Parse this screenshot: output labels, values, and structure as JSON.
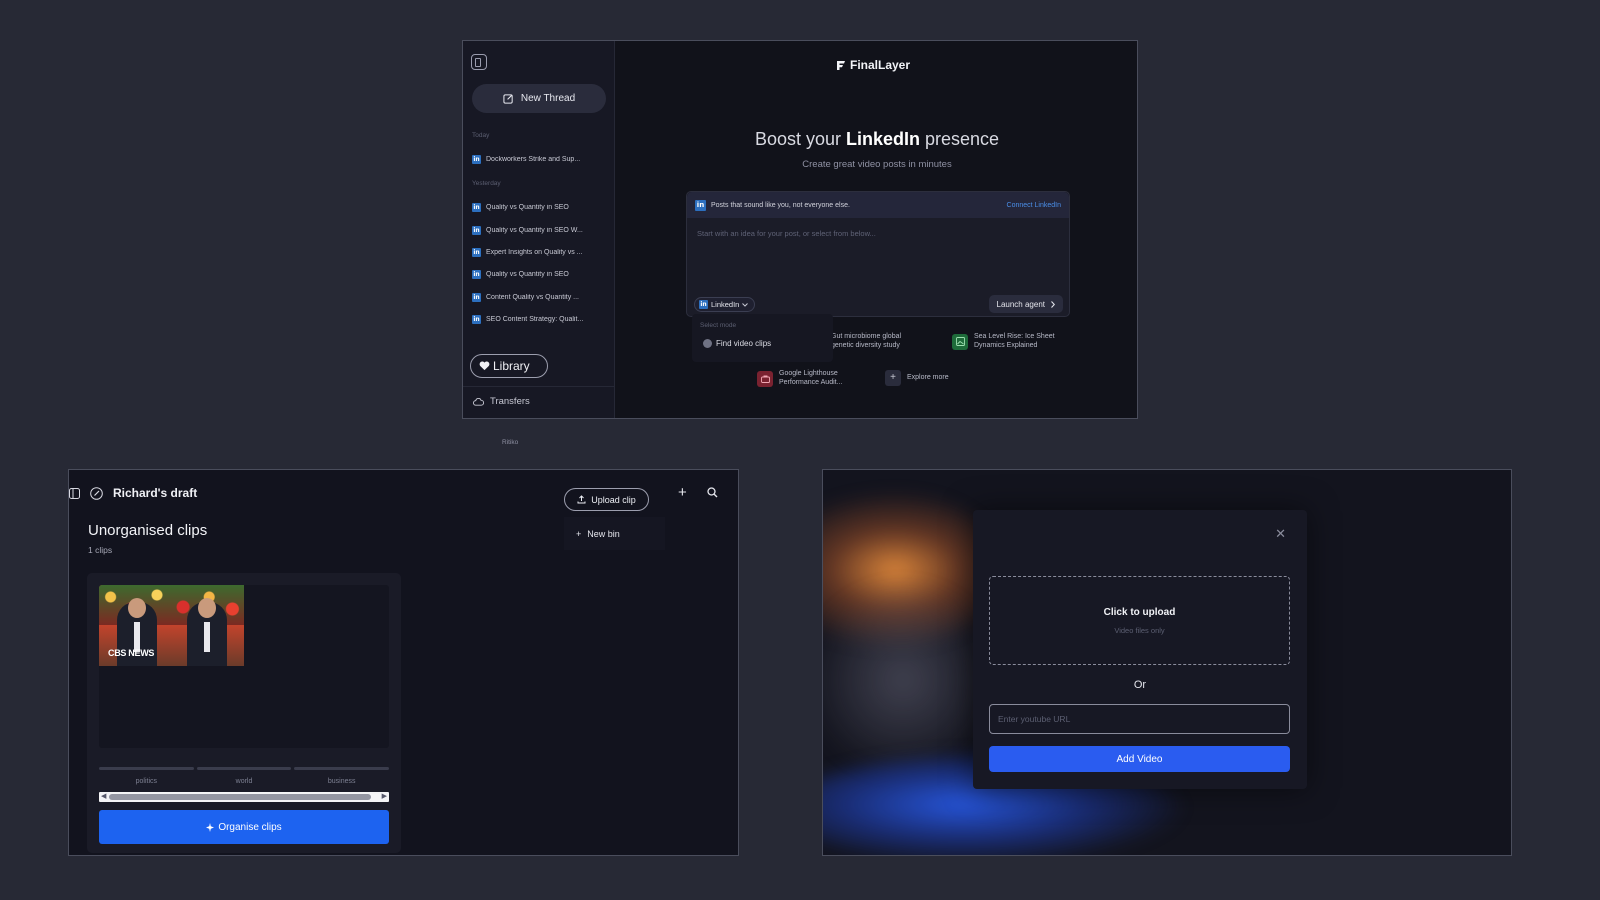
{
  "panel1": {
    "new_thread": "New Thread",
    "section_today": "Today",
    "section_yesterday": "Yesterday",
    "threads_today": [
      "Dockworkers Strike and Sup..."
    ],
    "threads_yesterday": [
      "Quality vs Quantity in SEO",
      "Quality vs Quantity in SEO W...",
      "Expert Insights on Quality vs ...",
      "Quality vs Quantity in SEO",
      "Content Quality vs Quantity ...",
      "SEO Content Strategy: Qualit..."
    ],
    "library": "Library",
    "transfers": "Transfers",
    "brand": "FinalLayer",
    "headline_pre": "Boost your ",
    "headline_bold": "LinkedIn",
    "headline_post": " presence",
    "subhead": "Create great video posts in minutes",
    "composer_banner": "Posts that sound like you, not everyone else.",
    "connect": "Connect LinkedIn",
    "composer_placeholder": "Start with an idea for your post, or select from below...",
    "platform": "LinkedIn",
    "launch": "Launch agent",
    "mode_label": "Select mode",
    "mode_option": "Find video clips",
    "suggestions": [
      {
        "line1": "Gut microbiome global",
        "line2": "genetic diversity study"
      },
      {
        "line1": "Sea Level Rise: Ice Sheet",
        "line2": "Dynamics Explained"
      },
      {
        "line1": "Google Lighthouse",
        "line2": "Performance Audit..."
      },
      {
        "line1": "Explore more",
        "line2": ""
      }
    ],
    "caption": "Ritiko"
  },
  "panel2": {
    "draft_title": "Richard's draft",
    "upload": "Upload clip",
    "new_bin": "New bin",
    "section_title": "Unorganised clips",
    "count": "1 clips",
    "watermark": "CBS NEWS",
    "tags": [
      "politics",
      "world",
      "business"
    ],
    "organise": "Organise clips"
  },
  "panel3": {
    "dz_title": "Click to upload",
    "dz_sub": "Video files only",
    "or": "Or",
    "url_placeholder": "Enter youtube URL",
    "add_video": "Add Video"
  }
}
